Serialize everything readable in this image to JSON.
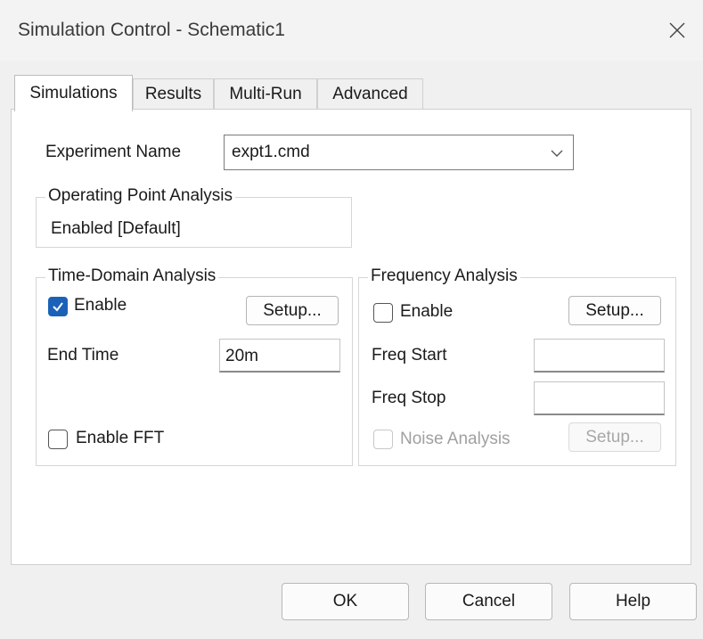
{
  "window": {
    "title": "Simulation Control - Schematic1",
    "close_icon": "close-icon"
  },
  "tabs": [
    {
      "label": "Simulations",
      "active": true
    },
    {
      "label": "Results",
      "active": false
    },
    {
      "label": "Multi-Run",
      "active": false
    },
    {
      "label": "Advanced",
      "active": false
    }
  ],
  "experiment": {
    "label": "Experiment Name",
    "value": "expt1.cmd"
  },
  "operating_point": {
    "title": "Operating Point Analysis",
    "status": "Enabled  [Default]"
  },
  "time_domain": {
    "title": "Time-Domain Analysis",
    "enable_label": "Enable",
    "enable_checked": true,
    "setup_label": "Setup...",
    "end_time_label": "End Time",
    "end_time_value": "20m",
    "fft_label": "Enable FFT",
    "fft_checked": false
  },
  "frequency": {
    "title": "Frequency Analysis",
    "enable_label": "Enable",
    "enable_checked": false,
    "setup_label": "Setup...",
    "freq_start_label": "Freq Start",
    "freq_start_value": "",
    "freq_stop_label": "Freq Stop",
    "freq_stop_value": "",
    "noise_label": "Noise Analysis",
    "noise_checked": false,
    "noise_setup_label": "Setup..."
  },
  "footer": {
    "ok_label": "OK",
    "cancel_label": "Cancel",
    "help_label": "Help"
  },
  "colors": {
    "accent": "#1a62b8",
    "dialog_bg": "#f0f0f0",
    "panel_bg": "#ffffff"
  }
}
